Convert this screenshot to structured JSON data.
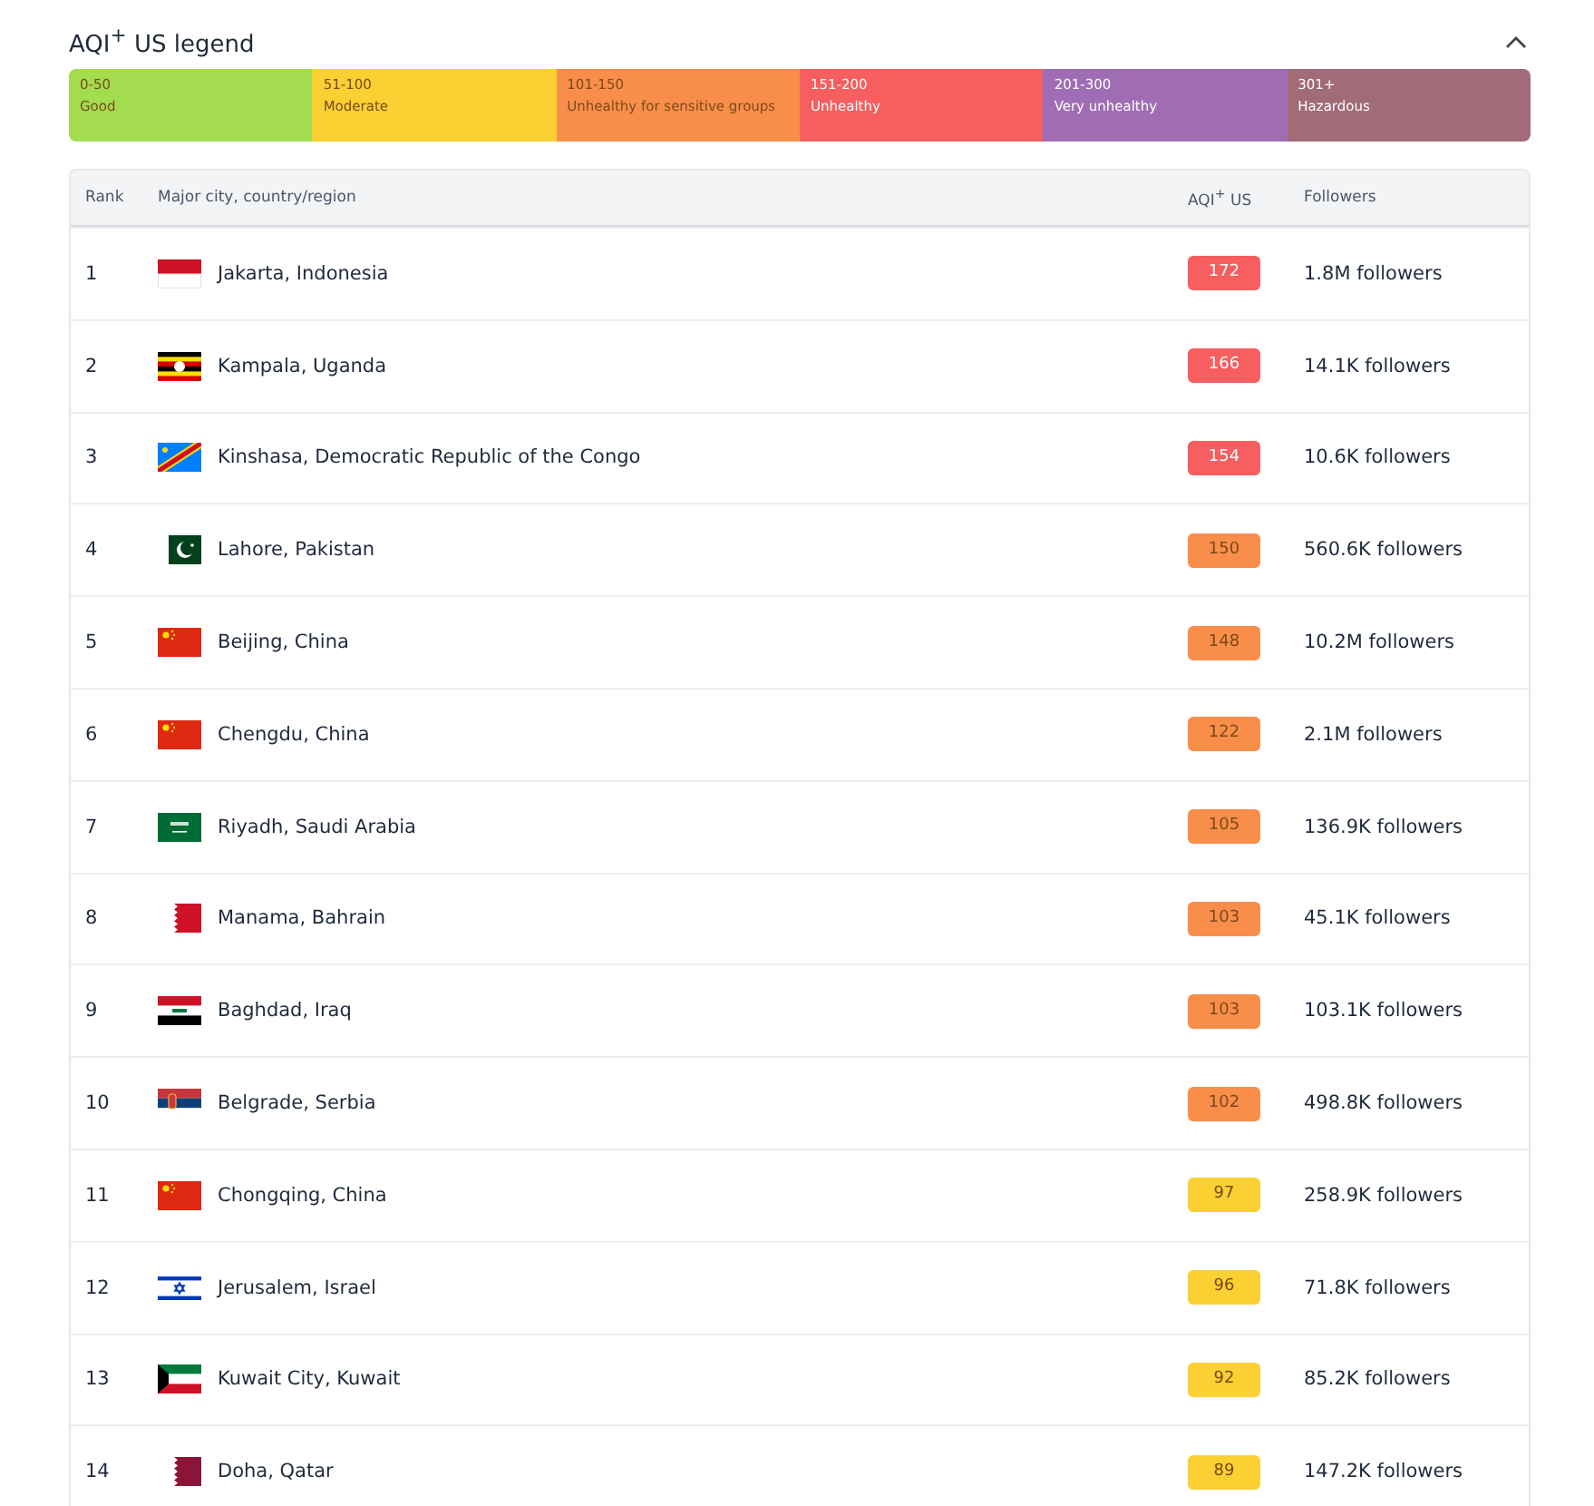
{
  "legend": {
    "title": "AQI$^{+}$ US legend",
    "expanded": true,
    "levels": [
      {
        "range": "0-50",
        "label": "Good",
        "color": "#a3dc4e"
      },
      {
        "range": "51-100",
        "label": "Moderate",
        "color": "#fbd033"
      },
      {
        "range": "101-150",
        "label": "Unhealthy for sensitive groups",
        "color": "#f98e4a"
      },
      {
        "range": "151-200",
        "label": "Unhealthy",
        "color": "#f65e60"
      },
      {
        "range": "201-300",
        "label": "Very unhealthy",
        "color": "#a06db5"
      },
      {
        "range": "301+",
        "label": "Hazardous",
        "color": "#a16b79"
      }
    ]
  },
  "table": {
    "columns": [
      "Rank",
      "Major city, country/region",
      "AQI$^{+}$ US",
      "Followers"
    ],
    "rows": [
      {
        "rank": "1",
        "kind": "indonesia",
        "city": "Jakarta, Indonesia",
        "aqi": "172",
        "color": "#f65e60",
        "followers": "1.8M followers"
      },
      {
        "rank": "2",
        "kind": "uganda",
        "city": "Kampala, Uganda",
        "aqi": "166",
        "color": "#f65e60",
        "followers": "14.1K followers"
      },
      {
        "rank": "3",
        "kind": "congo",
        "city": "Kinshasa, Democratic Republic of the Congo",
        "aqi": "154",
        "color": "#f65e60",
        "followers": "10.6K followers"
      },
      {
        "rank": "4",
        "kind": "pakistan",
        "city": "Lahore, Pakistan",
        "aqi": "150",
        "color": "#f98e4a",
        "followers": "560.6K followers"
      },
      {
        "rank": "5",
        "kind": "china",
        "city": "Beijing, China",
        "aqi": "148",
        "color": "#f98e4a",
        "followers": "10.2M followers"
      },
      {
        "rank": "6",
        "kind": "china",
        "city": "Chengdu, China",
        "aqi": "122",
        "color": "#f98e4a",
        "followers": "2.1M followers"
      },
      {
        "rank": "7",
        "kind": "saudi",
        "city": "Riyadh, Saudi Arabia",
        "aqi": "105",
        "color": "#f98e4a",
        "followers": "136.9K followers"
      },
      {
        "rank": "8",
        "kind": "bahrain",
        "city": "Manama, Bahrain",
        "aqi": "103",
        "color": "#f98e4a",
        "followers": "45.1K followers"
      },
      {
        "rank": "9",
        "kind": "iraq",
        "city": "Baghdad, Iraq",
        "aqi": "103",
        "color": "#f98e4a",
        "followers": "103.1K followers"
      },
      {
        "rank": "10",
        "kind": "serbia",
        "city": "Belgrade, Serbia",
        "aqi": "102",
        "color": "#f98e4a",
        "followers": "498.8K followers"
      },
      {
        "rank": "11",
        "kind": "china",
        "city": "Chongqing, China",
        "aqi": "97",
        "color": "#fbd033",
        "followers": "258.9K followers"
      },
      {
        "rank": "12",
        "kind": "israel",
        "city": "Jerusalem, Israel",
        "aqi": "96",
        "color": "#fbd033",
        "followers": "71.8K followers"
      },
      {
        "rank": "13",
        "kind": "kuwait",
        "city": "Kuwait City, Kuwait",
        "aqi": "92",
        "color": "#fbd033",
        "followers": "85.2K followers"
      },
      {
        "rank": "14",
        "kind": "qatar",
        "city": "Doha, Qatar",
        "aqi": "89",
        "color": "#fbd033",
        "followers": "147.2K followers"
      }
    ]
  }
}
